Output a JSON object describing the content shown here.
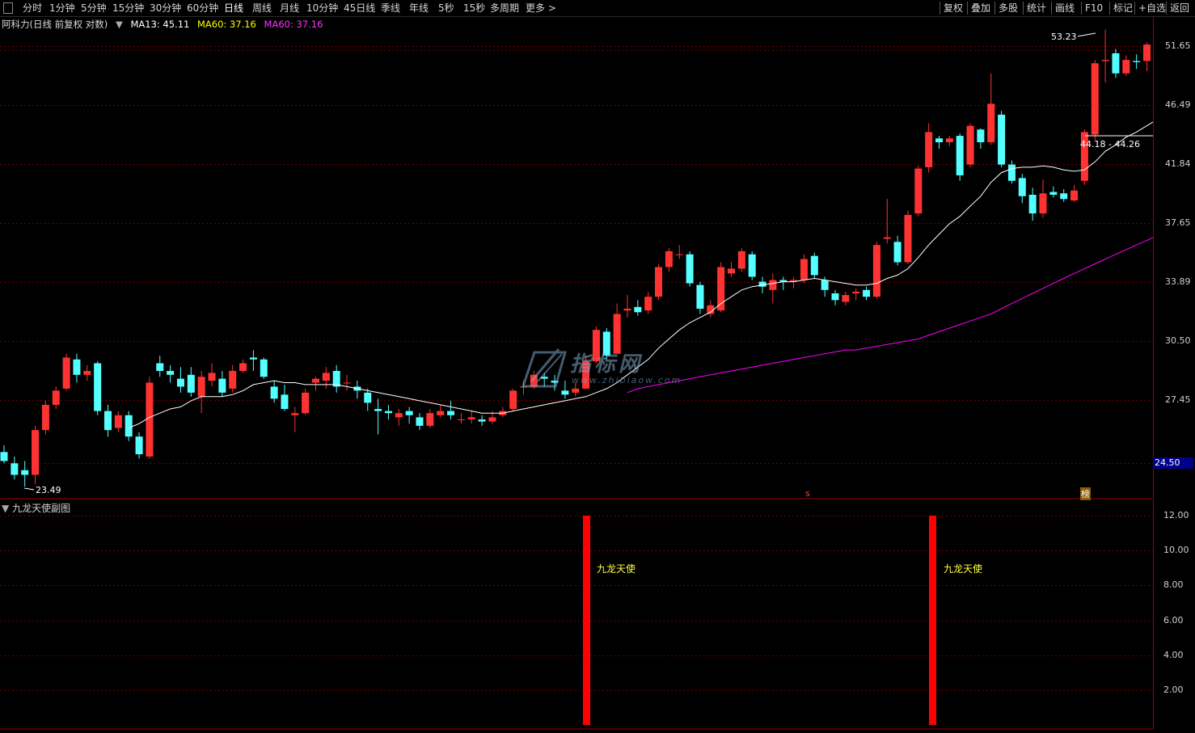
{
  "toolbar": {
    "left_items": [
      "分时",
      "1分钟",
      "5分钟",
      "15分钟",
      "30分钟",
      "60分钟",
      "日线",
      "周线",
      "月线",
      "10分钟",
      "45日线",
      "季线",
      "年线",
      "5秒",
      "15秒",
      "多周期",
      "更多 >"
    ],
    "active": "日线",
    "right_items": [
      "复权",
      "叠加",
      "多股",
      "统计",
      "画线",
      "F10",
      "标记",
      "+自选",
      "返回"
    ]
  },
  "info": {
    "stock": "阿科力(日线 前复权 对数)",
    "ma13": "MA13: 45.11",
    "ma60a": "MA60: 37.16",
    "ma60b": "MA60: 37.16"
  },
  "price_axis": {
    "ticks": [
      "51.65",
      "46.49",
      "41.84",
      "37.65",
      "33.89",
      "30.50",
      "27.45"
    ],
    "current": "24.50"
  },
  "annotations": {
    "high": "53.23",
    "low": "23.49",
    "range": "44.18 - 44.26",
    "marker_s": "s",
    "marker_bang": "榜"
  },
  "indicator": {
    "title": "九龙天使副图",
    "ticks": [
      "12.00",
      "10.00",
      "8.00",
      "6.00",
      "4.00",
      "2.00"
    ],
    "signal_label": "九龙天使",
    "signal_value": 12
  },
  "watermark": {
    "text": "指标网",
    "url": "www.zhibiaow.com"
  },
  "chart_data": {
    "type": "candlestick",
    "price_scale": "log",
    "ylim": [
      23.0,
      54.5
    ],
    "up_color": "#ff3232",
    "down_color": "#54ffff",
    "ma13_color": "#ffffff",
    "ma60_color": "#ff00ff",
    "candles": [
      [
        25.0,
        24.6,
        25.3,
        24.5
      ],
      [
        24.5,
        24.0,
        24.8,
        23.8
      ],
      [
        24.2,
        24.0,
        24.6,
        23.5
      ],
      [
        24.0,
        26.0,
        26.2,
        23.6
      ],
      [
        26.0,
        27.2,
        27.4,
        25.8
      ],
      [
        27.2,
        27.9,
        28.1,
        27.0
      ],
      [
        28.0,
        29.6,
        29.8,
        27.9
      ],
      [
        29.5,
        28.7,
        29.8,
        28.3
      ],
      [
        28.7,
        28.9,
        29.2,
        28.4
      ],
      [
        29.3,
        26.9,
        29.4,
        26.7
      ],
      [
        26.9,
        26.0,
        27.2,
        25.7
      ],
      [
        26.1,
        26.7,
        26.9,
        25.9
      ],
      [
        26.7,
        25.7,
        26.9,
        25.5
      ],
      [
        25.7,
        24.9,
        25.9,
        24.7
      ],
      [
        24.8,
        28.3,
        28.6,
        24.7
      ],
      [
        29.3,
        28.9,
        29.7,
        28.6
      ],
      [
        28.9,
        28.7,
        29.2,
        28.3
      ],
      [
        28.5,
        28.1,
        29.1,
        27.8
      ],
      [
        28.7,
        27.8,
        29.1,
        27.6
      ],
      [
        27.6,
        28.6,
        28.9,
        26.8
      ],
      [
        28.4,
        28.8,
        29.3,
        28.1
      ],
      [
        28.5,
        27.8,
        28.9,
        27.6
      ],
      [
        28.0,
        28.9,
        29.2,
        27.8
      ],
      [
        28.9,
        29.3,
        29.5,
        28.8
      ],
      [
        29.6,
        29.5,
        30.0,
        28.9
      ],
      [
        29.5,
        28.6,
        29.6,
        28.5
      ],
      [
        28.1,
        27.5,
        28.4,
        27.3
      ],
      [
        27.7,
        27.0,
        28.2,
        26.9
      ],
      [
        26.7,
        26.8,
        27.1,
        25.9
      ],
      [
        26.8,
        27.8,
        28.0,
        26.7
      ],
      [
        28.3,
        28.5,
        28.6,
        27.9
      ],
      [
        28.4,
        28.8,
        29.1,
        28.0
      ],
      [
        28.9,
        28.1,
        29.2,
        27.8
      ],
      [
        28.3,
        28.3,
        28.7,
        27.9
      ],
      [
        28.1,
        27.9,
        28.4,
        27.5
      ],
      [
        27.8,
        27.3,
        28.0,
        26.9
      ],
      [
        27.0,
        26.9,
        27.5,
        25.8
      ],
      [
        26.9,
        26.8,
        27.2,
        26.5
      ],
      [
        26.6,
        26.8,
        27.0,
        26.2
      ],
      [
        26.9,
        26.7,
        27.1,
        26.3
      ],
      [
        26.6,
        26.2,
        26.8,
        26.0
      ],
      [
        26.2,
        26.8,
        27.0,
        26.1
      ],
      [
        26.7,
        26.9,
        27.2,
        26.6
      ],
      [
        26.9,
        26.7,
        27.4,
        26.5
      ],
      [
        26.5,
        26.5,
        26.8,
        26.3
      ],
      [
        26.5,
        26.6,
        26.9,
        26.3
      ],
      [
        26.5,
        26.4,
        26.7,
        26.2
      ],
      [
        26.4,
        26.6,
        26.9,
        26.3
      ],
      [
        26.7,
        26.9,
        27.1,
        26.6
      ],
      [
        27.0,
        27.9,
        28.0,
        26.9
      ],
      [
        28.1,
        28.1,
        28.4,
        27.7
      ],
      [
        28.1,
        28.7,
        28.9,
        28.0
      ],
      [
        28.6,
        28.5,
        28.8,
        28.1
      ],
      [
        28.4,
        28.3,
        28.7,
        27.9
      ],
      [
        27.9,
        27.7,
        28.4,
        27.5
      ],
      [
        27.8,
        28.0,
        28.3,
        27.6
      ],
      [
        28.0,
        29.4,
        29.7,
        28.0
      ],
      [
        29.4,
        31.1,
        31.3,
        29.3
      ],
      [
        31.0,
        29.7,
        31.2,
        29.5
      ],
      [
        29.8,
        32.0,
        32.6,
        29.8
      ],
      [
        32.2,
        32.3,
        33.1,
        31.8
      ],
      [
        32.4,
        32.1,
        32.8,
        31.9
      ],
      [
        32.2,
        33.0,
        33.3,
        32.0
      ],
      [
        33.0,
        34.8,
        35.0,
        32.8
      ],
      [
        34.8,
        35.8,
        36.0,
        34.5
      ],
      [
        35.6,
        35.6,
        36.2,
        35.3
      ],
      [
        35.6,
        33.8,
        35.8,
        33.6
      ],
      [
        33.7,
        32.3,
        33.9,
        32.0
      ],
      [
        32.0,
        32.5,
        32.8,
        31.8
      ],
      [
        32.2,
        34.8,
        35.1,
        32.1
      ],
      [
        34.4,
        34.7,
        35.1,
        34.2
      ],
      [
        34.7,
        35.8,
        36.0,
        34.5
      ],
      [
        35.6,
        34.2,
        35.8,
        34.0
      ],
      [
        33.9,
        33.6,
        34.2,
        33.2
      ],
      [
        33.4,
        34.0,
        34.4,
        32.6
      ],
      [
        34.0,
        33.9,
        34.2,
        33.4
      ],
      [
        33.9,
        34.0,
        34.2,
        33.5
      ],
      [
        34.0,
        35.3,
        35.6,
        33.8
      ],
      [
        35.5,
        34.3,
        35.7,
        34.1
      ],
      [
        34.0,
        33.4,
        34.2,
        33.0
      ],
      [
        33.2,
        32.8,
        33.4,
        32.5
      ],
      [
        32.7,
        33.1,
        33.3,
        32.5
      ],
      [
        33.2,
        33.3,
        33.5,
        32.8
      ],
      [
        33.4,
        33.0,
        33.6,
        32.8
      ],
      [
        33.0,
        36.2,
        36.4,
        32.9
      ],
      [
        36.6,
        36.7,
        39.3,
        36.3
      ],
      [
        36.4,
        35.1,
        36.8,
        34.9
      ],
      [
        35.1,
        38.2,
        38.5,
        35.0
      ],
      [
        38.3,
        41.5,
        41.7,
        38.1
      ],
      [
        41.6,
        44.3,
        45.0,
        41.2
      ],
      [
        43.8,
        43.5,
        44.0,
        43.0
      ],
      [
        43.5,
        43.8,
        44.0,
        43.2
      ],
      [
        44.0,
        41.0,
        44.2,
        40.6
      ],
      [
        41.8,
        44.8,
        45.0,
        41.6
      ],
      [
        44.5,
        43.5,
        44.6,
        43.0
      ],
      [
        43.5,
        46.6,
        49.2,
        43.3
      ],
      [
        45.7,
        41.8,
        46.0,
        41.6
      ],
      [
        41.8,
        40.6,
        42.1,
        40.4
      ],
      [
        40.8,
        39.5,
        41.1,
        39.0
      ],
      [
        39.6,
        38.3,
        40.1,
        37.8
      ],
      [
        38.3,
        39.7,
        40.7,
        38.0
      ],
      [
        39.8,
        39.6,
        40.2,
        39.4
      ],
      [
        39.7,
        39.3,
        40.0,
        39.1
      ],
      [
        39.2,
        39.9,
        40.3,
        39.1
      ],
      [
        40.6,
        44.3,
        44.5,
        40.3
      ],
      [
        44.1,
        50.1,
        50.4,
        43.6
      ],
      [
        50.3,
        50.4,
        53.2,
        48.4
      ],
      [
        51.0,
        49.2,
        51.4,
        48.8
      ],
      [
        49.2,
        50.4,
        50.8,
        49.0
      ],
      [
        50.3,
        50.2,
        50.9,
        49.6
      ],
      [
        50.3,
        51.8,
        52.0,
        49.4
      ],
      [
        50.4,
        52.4,
        52.5,
        50.3
      ],
      [
        52.4,
        51.6,
        52.5,
        50.5
      ]
    ],
    "ma13_values": [
      null,
      null,
      null,
      null,
      null,
      null,
      null,
      null,
      null,
      null,
      null,
      null,
      26.1,
      26.3,
      26.6,
      26.8,
      27.0,
      27.1,
      27.4,
      27.6,
      27.6,
      27.6,
      27.7,
      27.9,
      28.2,
      28.3,
      28.4,
      28.3,
      28.3,
      28.2,
      28.2,
      28.2,
      28.2,
      28.1,
      28.0,
      27.9,
      27.8,
      27.7,
      27.6,
      27.5,
      27.4,
      27.3,
      27.2,
      27.1,
      27.0,
      26.9,
      26.8,
      26.8,
      26.8,
      26.9,
      27.0,
      27.1,
      27.2,
      27.3,
      27.4,
      27.5,
      27.6,
      27.8,
      28.0,
      28.3,
      28.7,
      29.1,
      29.5,
      30.1,
      30.6,
      31.1,
      31.5,
      31.8,
      32.1,
      32.6,
      33.0,
      33.4,
      33.6,
      33.7,
      33.8,
      33.9,
      33.9,
      34.0,
      34.1,
      34.0,
      33.9,
      33.8,
      33.7,
      33.7,
      33.8,
      34.1,
      34.3,
      34.7,
      35.4,
      36.2,
      36.9,
      37.6,
      38.1,
      38.8,
      39.5,
      40.5,
      41.2,
      41.5,
      41.6,
      41.6,
      41.7,
      41.6,
      41.4,
      41.3,
      41.4,
      42.0,
      42.8,
      43.3,
      43.9,
      44.3,
      44.8,
      45.3,
      45.6
    ],
    "ma60_values": [
      27.8,
      28.0,
      28.1,
      28.2,
      28.3,
      28.4,
      28.5,
      28.6,
      28.7,
      28.8,
      28.9,
      29.0,
      29.1,
      29.2,
      29.3,
      29.4,
      29.5,
      29.6,
      29.7,
      29.8,
      29.9,
      30.0,
      30.0,
      30.1,
      30.2,
      30.3,
      30.4,
      30.5,
      30.6,
      30.8,
      31.0,
      31.2,
      31.4,
      31.6,
      31.8,
      32.0,
      32.3,
      32.6,
      32.9,
      33.2,
      33.5,
      33.8,
      34.1,
      34.4,
      34.7,
      35.0,
      35.3,
      35.6,
      35.9,
      36.2,
      36.5,
      36.8,
      37.16
    ]
  }
}
